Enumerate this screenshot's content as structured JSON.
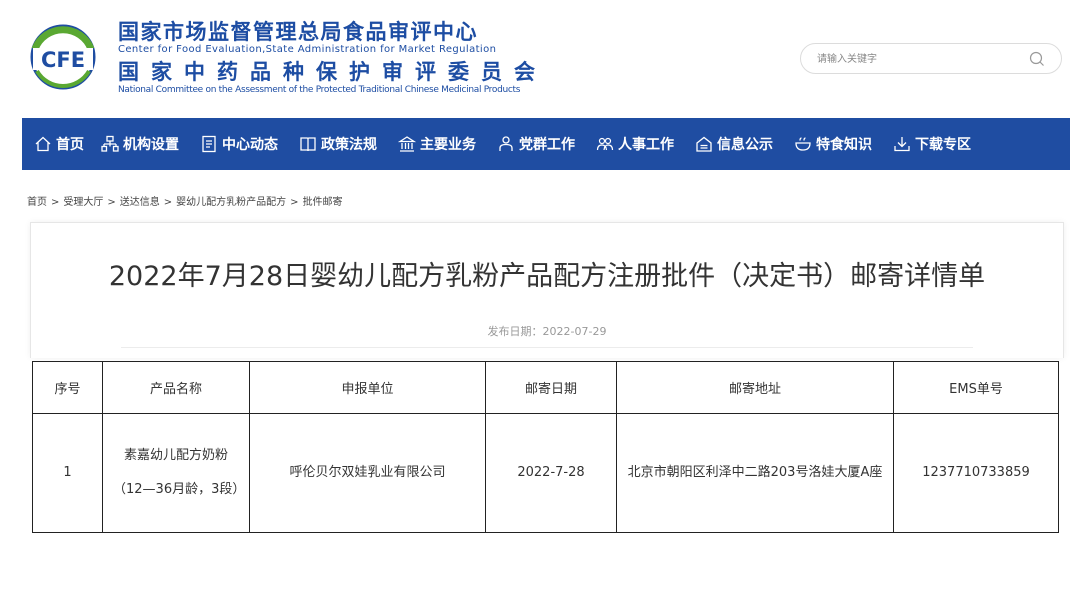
{
  "header": {
    "logo_text": "CFE",
    "title_cn": "国家市场监督管理总局食品审评中心",
    "title_en": "Center for Food Evaluation,State Administration for Market Regulation",
    "subtitle_cn": "国家中药品种保护审评委员会",
    "subtitle_en": "National Committee on the Assessment of the Protected Traditional Chinese Medicinal Products"
  },
  "search": {
    "placeholder": "请输入关键字"
  },
  "nav": {
    "items": [
      {
        "label": "首页",
        "icon": "home-icon"
      },
      {
        "label": "机构设置",
        "icon": "org-chart-icon"
      },
      {
        "label": "中心动态",
        "icon": "news-icon"
      },
      {
        "label": "政策法规",
        "icon": "book-icon"
      },
      {
        "label": "主要业务",
        "icon": "bank-icon"
      },
      {
        "label": "党群工作",
        "icon": "person-icon"
      },
      {
        "label": "人事工作",
        "icon": "people-icon"
      },
      {
        "label": "信息公示",
        "icon": "notice-icon"
      },
      {
        "label": "特食知识",
        "icon": "bowl-icon"
      },
      {
        "label": "下载专区",
        "icon": "download-icon"
      }
    ]
  },
  "breadcrumb": {
    "items": [
      "首页",
      "受理大厅",
      "送达信息",
      "婴幼儿配方乳粉产品配方",
      "批件邮寄"
    ],
    "separator": ">"
  },
  "article": {
    "title": "2022年7月28日婴幼儿配方乳粉产品配方注册批件（决定书）邮寄详情单",
    "publish_date": "发布日期：2022-07-29"
  },
  "table": {
    "headers": [
      "序号",
      "产品名称",
      "申报单位",
      "邮寄日期",
      "邮寄地址",
      "EMS单号"
    ],
    "rows": [
      {
        "index": "1",
        "product": "素嘉幼儿配方奶粉（12—36月龄，3段）",
        "applicant": "呼伦贝尔双娃乳业有限公司",
        "date": "2022-7-28",
        "address": "北京市朝阳区利泽中二路203号洛娃大厦A座",
        "ems": "1237710733859"
      }
    ]
  },
  "colors": {
    "brand_blue": "#1f4da2",
    "logo_green": "#5aa832",
    "text": "#333333"
  }
}
